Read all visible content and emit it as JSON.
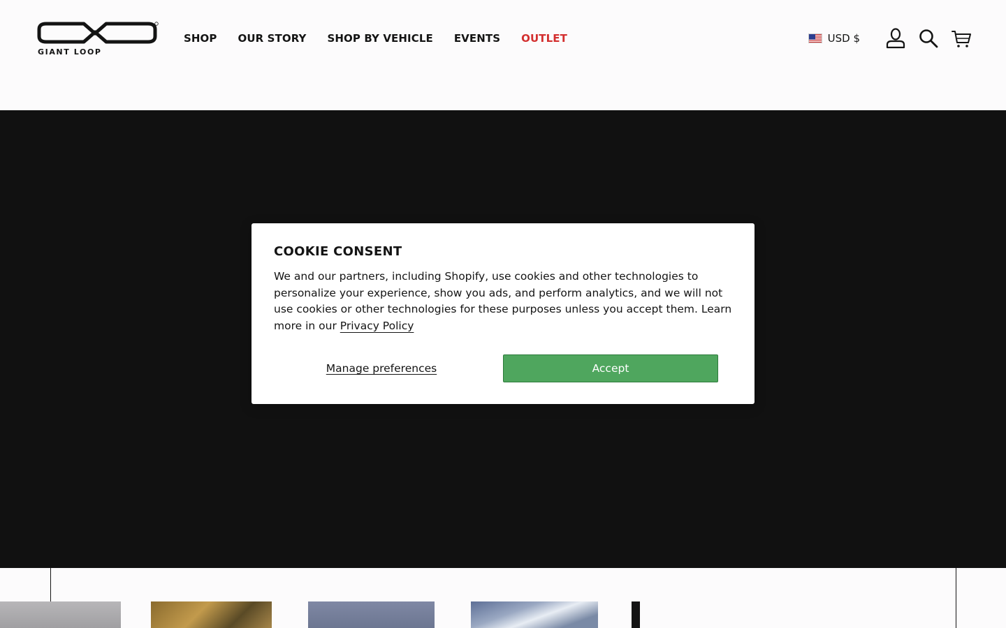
{
  "brand": {
    "name": "GIANT LOOP",
    "registered_mark": "®"
  },
  "nav": {
    "items": [
      {
        "label": "SHOP"
      },
      {
        "label": "OUR STORY"
      },
      {
        "label": "SHOP BY VEHICLE"
      },
      {
        "label": "EVENTS"
      },
      {
        "label": "OUTLET"
      }
    ]
  },
  "utilities": {
    "currency_label": "USD $",
    "flag_icon": "us-flag-icon",
    "account_icon": "user-icon",
    "search_icon": "search-icon",
    "cart_icon": "cart-icon"
  },
  "cookie_modal": {
    "title": "COOKIE CONSENT",
    "body": "We and our partners, including Shopify, use cookies and other technologies to personalize your experience, show you ads, and perform analytics, and we will not use cookies or other technologies for these purposes unless you accept them. Learn more in our",
    "privacy_link": "Privacy Policy",
    "manage_label": "Manage preferences",
    "accept_label": "Accept"
  },
  "colors": {
    "hero_bg": "#111111",
    "outlet": "#d32f2f",
    "accept": "#4fa65e"
  }
}
